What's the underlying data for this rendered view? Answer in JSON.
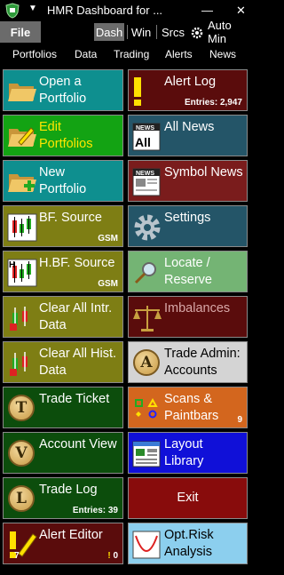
{
  "titlebar": {
    "title": "HMR Dashboard for ..."
  },
  "tabs": {
    "file": "File",
    "dash": "Dash",
    "win": "Win",
    "srcs": "Srcs",
    "automin": "Auto Min"
  },
  "menu": {
    "portfolios": "Portfolios",
    "data": "Data",
    "trading": "Trading",
    "alerts": "Alerts",
    "news": "News"
  },
  "tiles": {
    "open_portfolio": {
      "label": "Open a\nPortfolio"
    },
    "edit_portfolios": {
      "label": "Edit\nPortfolios"
    },
    "new_portfolio": {
      "label": "New\nPortfolio"
    },
    "bf_source": {
      "label": "BF. Source",
      "sub": "GSM"
    },
    "hbf_source": {
      "label": "H.BF. Source",
      "sub": "GSM"
    },
    "clear_intr": {
      "label": "Clear All Intr.\nData"
    },
    "clear_hist": {
      "label": "Clear All Hist.\nData"
    },
    "trade_ticket": {
      "label": "Trade Ticket"
    },
    "account_view": {
      "label": "Account View"
    },
    "trade_log": {
      "label": "Trade Log",
      "sub": "Entries:  39"
    },
    "alert_editor": {
      "label": "Alert Editor",
      "sub_left": "7",
      "sub_right": "0"
    },
    "alert_log": {
      "label": "Alert Log",
      "sub": "Entries:  2,947"
    },
    "all_news": {
      "label": "All News"
    },
    "symbol_news": {
      "label": "Symbol News"
    },
    "settings": {
      "label": "Settings"
    },
    "locate": {
      "label": "Locate /\nReserve"
    },
    "imbalances": {
      "label": "Imbalances"
    },
    "trade_admin": {
      "label": "Trade Admin:\nAccounts"
    },
    "scans": {
      "label": "Scans &\nPaintbars",
      "sub": "9"
    },
    "layout_library": {
      "label": "Layout\nLibrary"
    },
    "exit": {
      "label": "Exit"
    },
    "opt_risk": {
      "label": "Opt.Risk\nAnalysis"
    }
  }
}
